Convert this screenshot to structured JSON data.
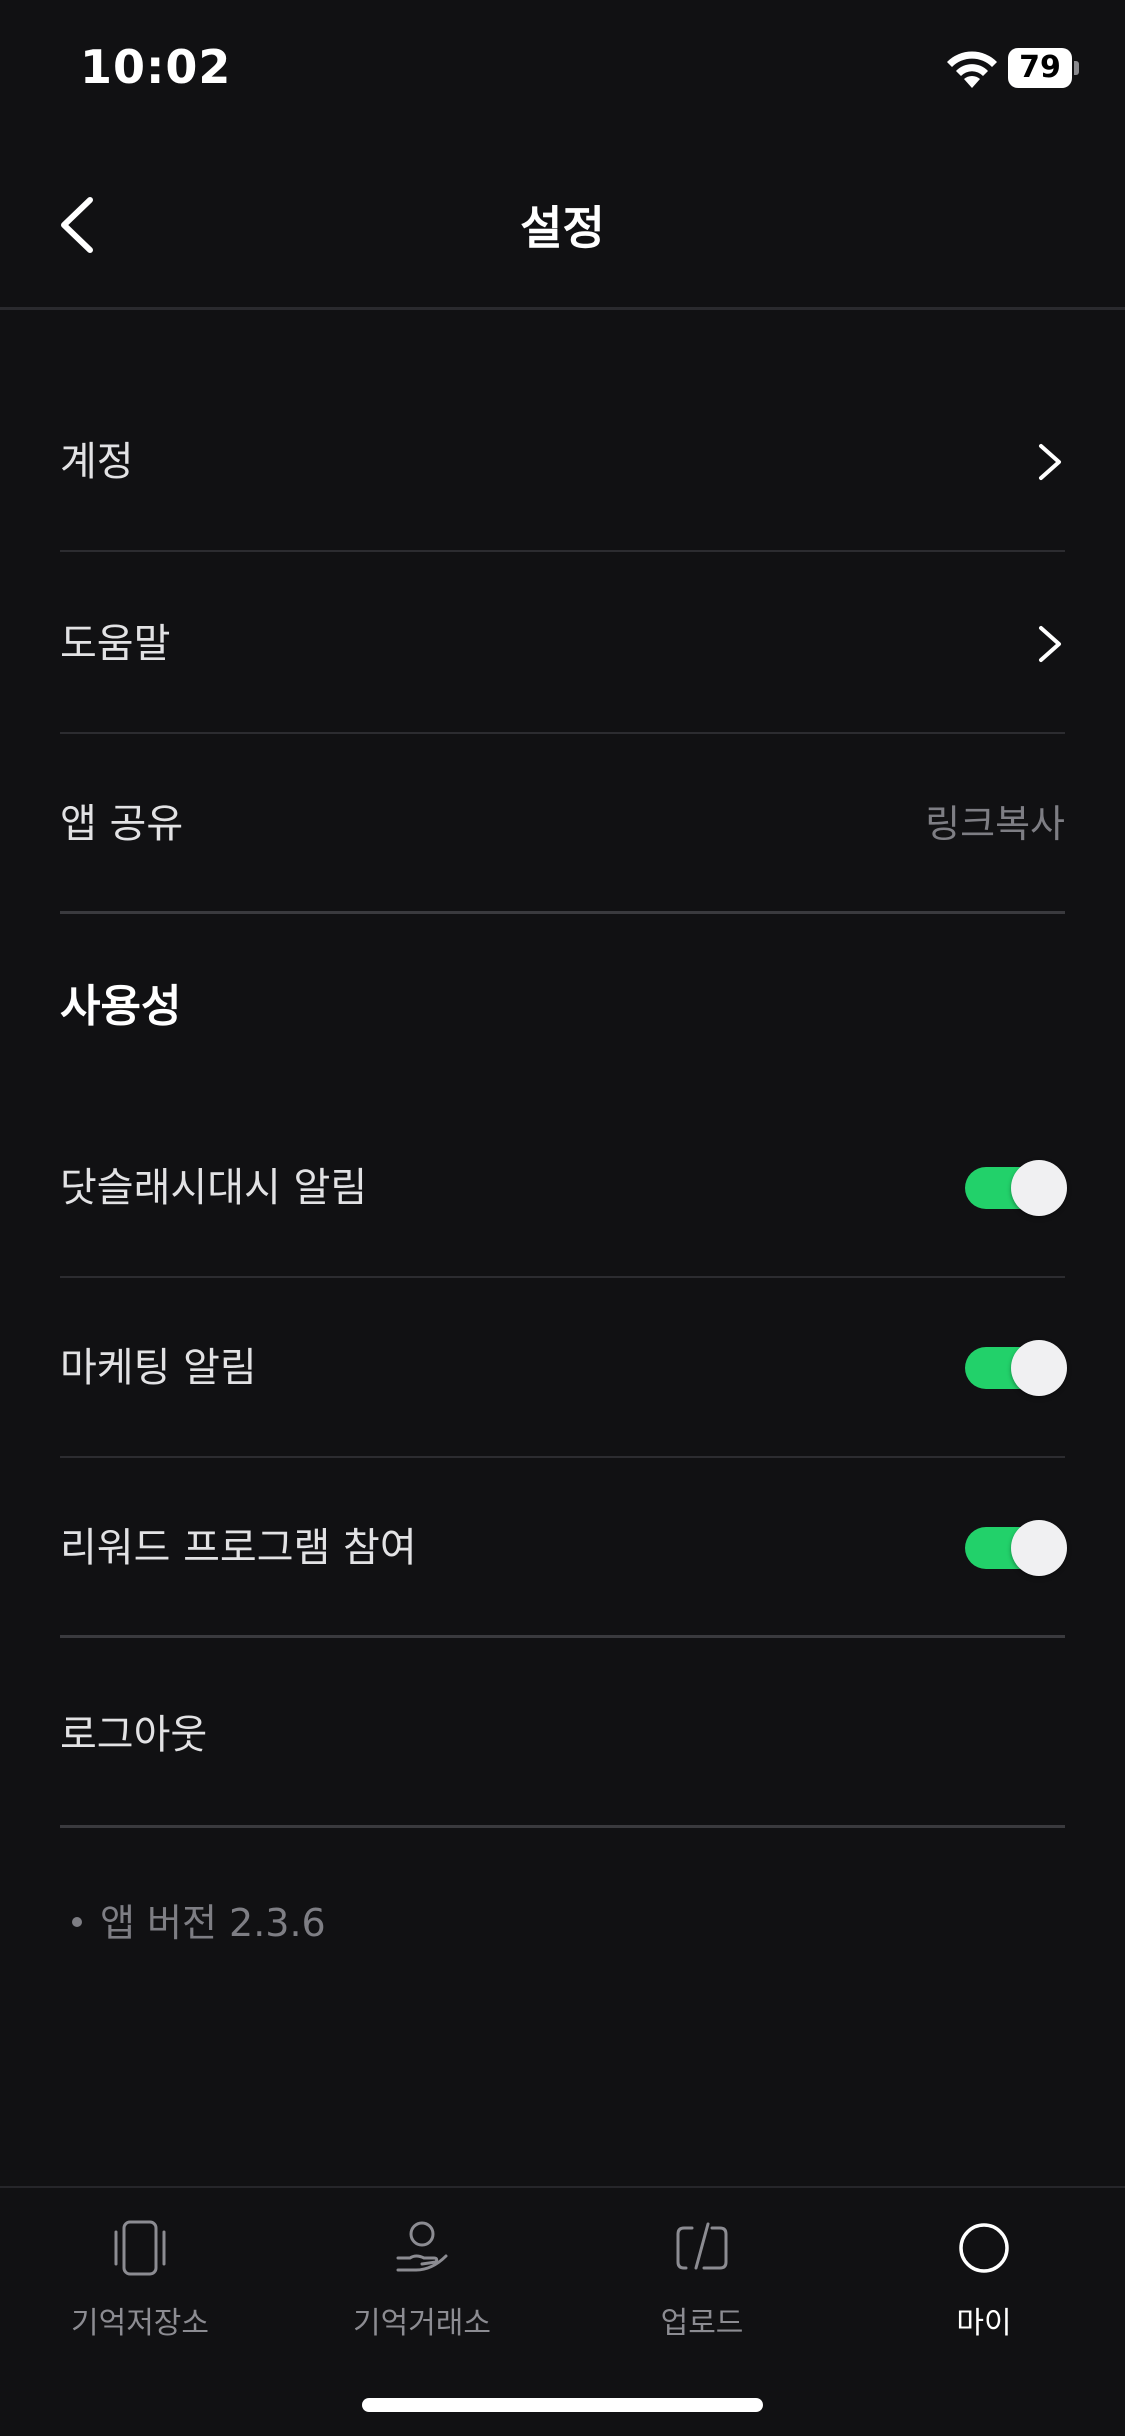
{
  "status_bar": {
    "time": "10:02",
    "battery": "79"
  },
  "nav": {
    "title": "설정"
  },
  "rows": [
    {
      "label": "계정"
    },
    {
      "label": "도움말"
    },
    {
      "label": "앱 공유",
      "value": "링크복사"
    }
  ],
  "section": {
    "title": "사용성"
  },
  "toggles": [
    {
      "label": "닷슬래시대시 알림",
      "on": true
    },
    {
      "label": "마케팅 알림",
      "on": true
    },
    {
      "label": "리워드 프로그램 참여",
      "on": true
    }
  ],
  "logout": {
    "label": "로그아웃"
  },
  "version": {
    "text": "앱 버전 2.3.6"
  },
  "tabs": [
    {
      "label": "기억저장소",
      "icon": "phone-frame-icon"
    },
    {
      "label": "기억거래소",
      "icon": "hand-person-icon"
    },
    {
      "label": "업로드",
      "icon": "upload-slash-icon"
    },
    {
      "label": "마이",
      "icon": "circle-icon",
      "active": true
    }
  ],
  "colors": {
    "background": "#111113",
    "toggle_on": "#22d16a",
    "muted_text": "#7e7e84"
  }
}
